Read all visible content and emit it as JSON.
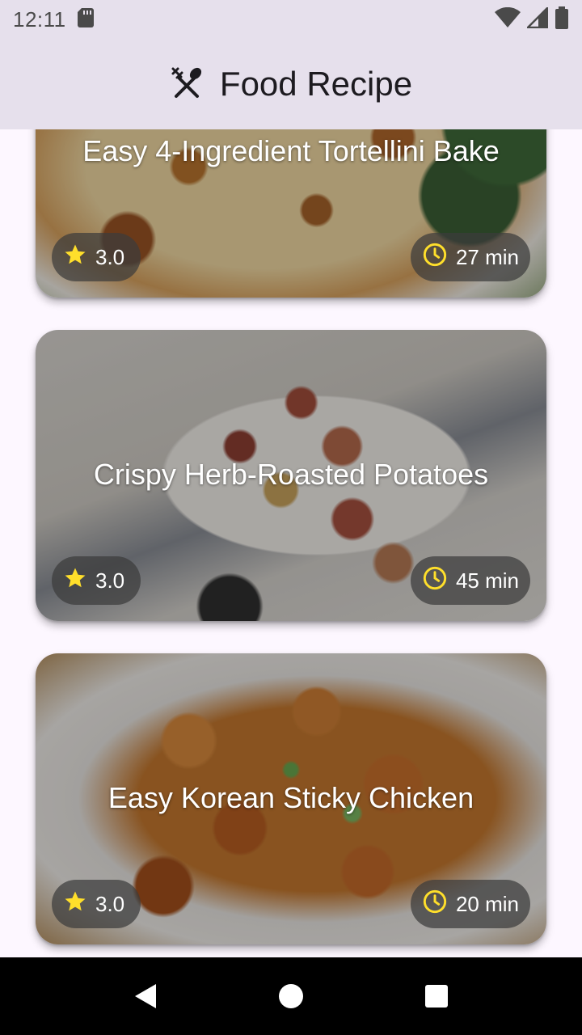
{
  "status_bar": {
    "time": "12:11",
    "icons": [
      "sd-card-icon",
      "wifi-icon",
      "cell-signal-icon",
      "battery-icon"
    ]
  },
  "app_bar": {
    "title": "Food Recipe",
    "icon": "utensils-crossed-icon"
  },
  "recipes": [
    {
      "title": "Easy 4-Ingredient Tortellini Bake",
      "rating": "3.0",
      "time": "27 min"
    },
    {
      "title": "Crispy Herb-Roasted Potatoes",
      "rating": "3.0",
      "time": "45 min"
    },
    {
      "title": "Easy Korean Sticky Chicken",
      "rating": "3.0",
      "time": "20 min"
    }
  ],
  "colors": {
    "app_bar_bg": "#e6e0ec",
    "page_bg": "#fdf7ff",
    "star": "#ffdf2b",
    "clock": "#ffdf2b",
    "chip_bg": "#3c3c3c"
  },
  "nav_bar": {
    "buttons": [
      "back-icon",
      "home-icon",
      "recents-icon"
    ]
  }
}
